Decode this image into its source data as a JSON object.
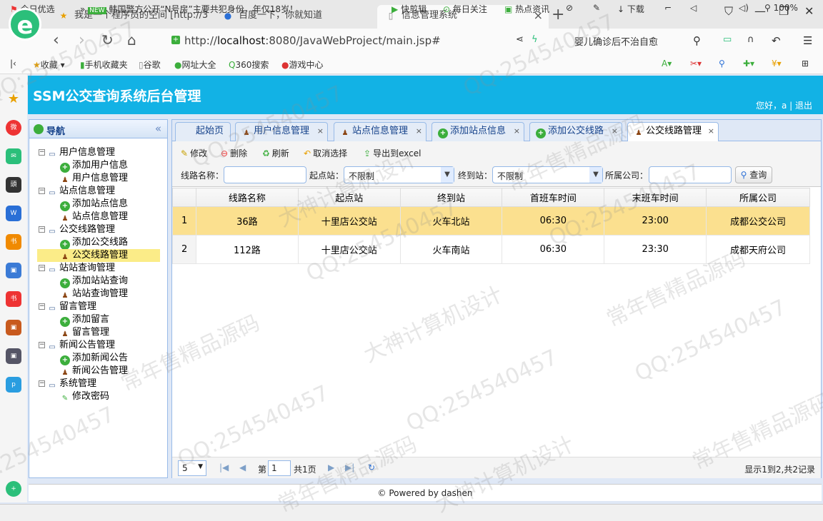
{
  "browser": {
    "tabs": [
      {
        "label": "我是一个程序员的空间 [http://3",
        "icon": "star-icon"
      },
      {
        "label": "百度一下，你就知道",
        "icon": "paw-icon"
      },
      {
        "label": "信息管理系统",
        "icon": "page-icon"
      }
    ],
    "url_prefix": "http://",
    "url_host": "localhost",
    "url_rest": ":8080/JavaWebProject/main.jsp#",
    "search_hint": "婴儿确诊后不治自愈",
    "bookmarks": [
      "收藏",
      "手机收藏夹",
      "谷歌",
      "网址大全",
      "360搜索",
      "游戏中心"
    ]
  },
  "app": {
    "title": "SSM公交查询系统后台管理",
    "greeting": "您好，a",
    "logout": "退出"
  },
  "nav": {
    "heading": "导航",
    "groups": [
      {
        "label": "用户信息管理",
        "items": [
          "添加用户信息",
          "用户信息管理"
        ]
      },
      {
        "label": "站点信息管理",
        "items": [
          "添加站点信息",
          "站点信息管理"
        ]
      },
      {
        "label": "公交线路管理",
        "items": [
          "添加公交线路",
          "公交线路管理"
        ]
      },
      {
        "label": "站站查询管理",
        "items": [
          "添加站站查询",
          "站站查询管理"
        ]
      },
      {
        "label": "留言管理",
        "items": [
          "添加留言",
          "留言管理"
        ]
      },
      {
        "label": "新闻公告管理",
        "items": [
          "添加新闻公告",
          "新闻公告管理"
        ]
      },
      {
        "label": "系统管理",
        "items": [
          "修改密码"
        ]
      }
    ]
  },
  "tabs": [
    "起始页",
    "用户信息管理",
    "站点信息管理",
    "添加站点信息",
    "添加公交线路",
    "公交线路管理"
  ],
  "toolbar": {
    "edit": "修改",
    "delete": "删除",
    "refresh": "刷新",
    "cancel_select": "取消选择",
    "export": "导出到excel"
  },
  "filter": {
    "line_label": "线路名称：",
    "start_label": "起点站：",
    "start_value": "不限制",
    "end_label": "终到站：",
    "end_value": "不限制",
    "company_label": "所属公司：",
    "query": "查询"
  },
  "table": {
    "headers": [
      "线路名称",
      "起点站",
      "终到站",
      "首班车时间",
      "末班车时间",
      "所属公司"
    ],
    "rows": [
      [
        "1",
        "36路",
        "十里店公交站",
        "火车北站",
        "06:30",
        "23:00",
        "成都公交公司"
      ],
      [
        "2",
        "112路",
        "十里店公交站",
        "火车南站",
        "06:30",
        "23:30",
        "成都天府公司"
      ]
    ]
  },
  "pager": {
    "page_size": "5",
    "page_prefix": "第",
    "page": "1",
    "page_suffix": "共1页",
    "summary": "显示1到2,共2记录"
  },
  "footer": "© Powered by dashen",
  "statusbar": [
    "今日优选",
    "韩国警方公开“N号房”主要共犯身份，年仅18岁！",
    "快剪辑",
    "每日关注",
    "热点资讯",
    "下载",
    "100%"
  ],
  "watermark": [
    "QQ:254540457",
    "常年售精品源码",
    "大神计算机设计"
  ]
}
